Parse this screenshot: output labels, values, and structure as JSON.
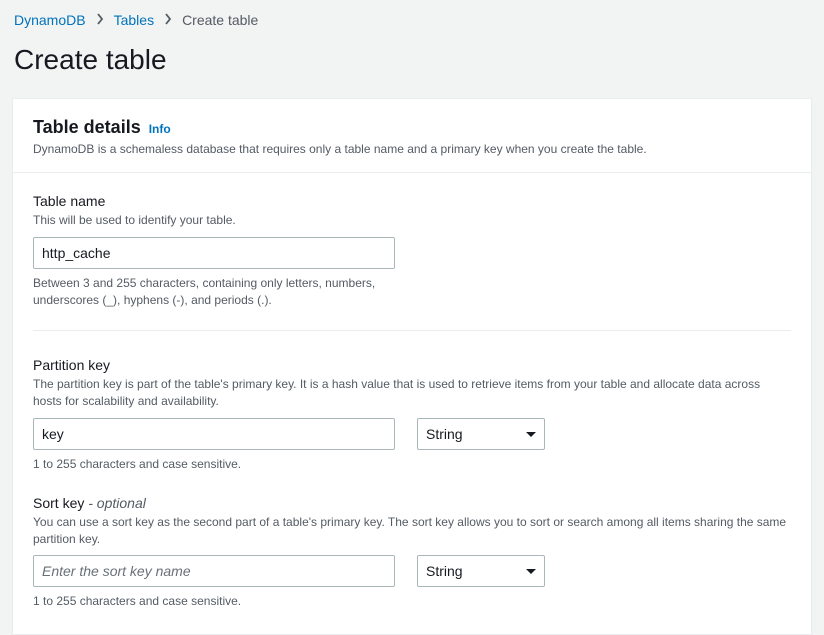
{
  "breadcrumb": {
    "root": "DynamoDB",
    "item1": "Tables",
    "current": "Create table"
  },
  "page_title": "Create table",
  "panel": {
    "title": "Table details",
    "info_label": "Info",
    "description": "DynamoDB is a schemaless database that requires only a table name and a primary key when you create the table."
  },
  "table_name": {
    "label": "Table name",
    "hint": "This will be used to identify your table.",
    "value": "http_cache",
    "constraint": "Between 3 and 255 characters, containing only letters, numbers, underscores (_), hyphens (-), and periods (.)."
  },
  "partition_key": {
    "label": "Partition key",
    "hint": "The partition key is part of the table's primary key. It is a hash value that is used to retrieve items from your table and allocate data across hosts for scalability and availability.",
    "value": "key",
    "type_value": "String",
    "constraint": "1 to 255 characters and case sensitive."
  },
  "sort_key": {
    "label": "Sort key",
    "optional_label": " - optional",
    "hint": "You can use a sort key as the second part of a table's primary key. The sort key allows you to sort or search among all items sharing the same partition key.",
    "value": "",
    "placeholder": "Enter the sort key name",
    "type_value": "String",
    "constraint": "1 to 255 characters and case sensitive."
  }
}
